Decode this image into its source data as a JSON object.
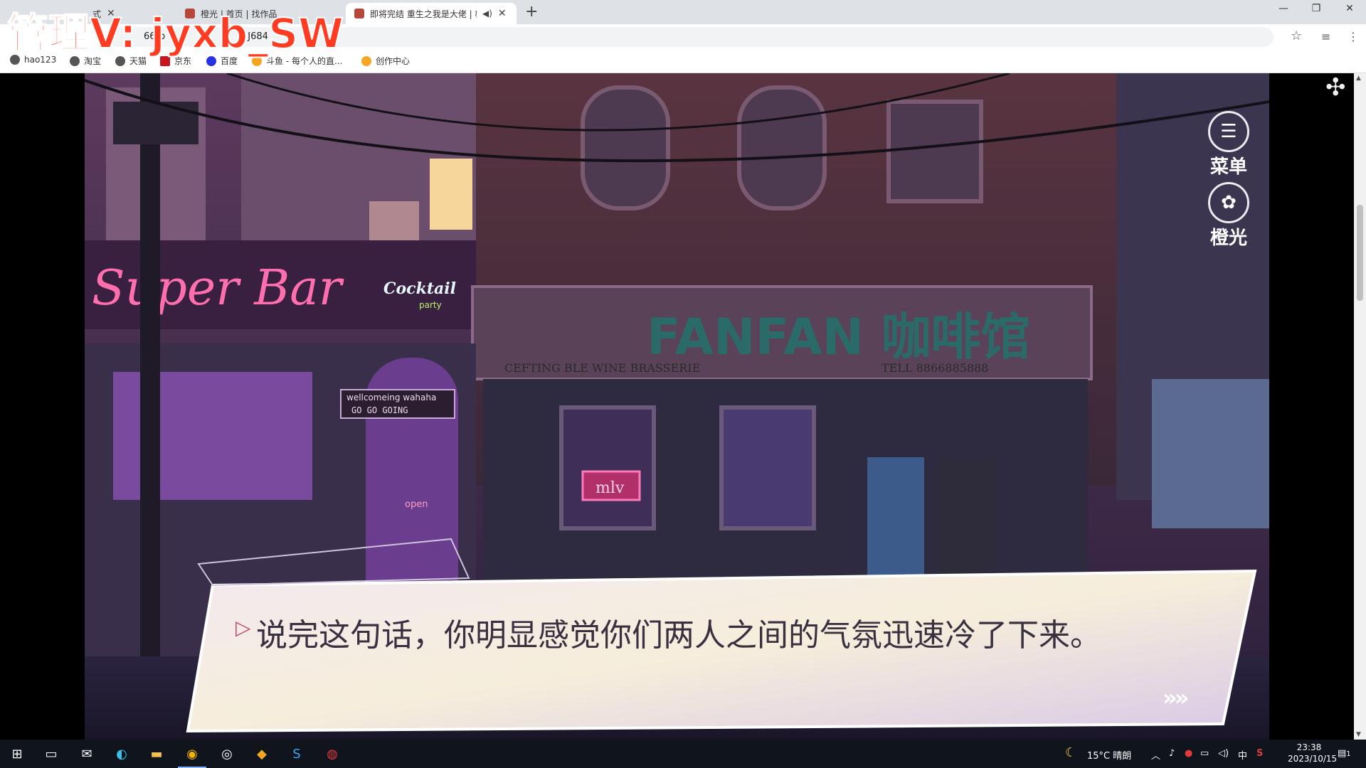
{
  "browser": {
    "tabs": [
      {
        "title": "式",
        "active": false
      },
      {
        "title": "橙光 | 首页 | 找作品",
        "active": false
      },
      {
        "title": "即将完结 重生之我是大佬 | 橙",
        "active": true
      }
    ],
    "url": "66rp",
    "url_suffix": "J684",
    "bookmarks": [
      "hao123",
      "淘宝",
      "天猫",
      "京东",
      "百度",
      "斗鱼 - 每个人的直...",
      "创作中心"
    ]
  },
  "watermark": "管理V: jyxb_SW",
  "game": {
    "menu_label": "菜单",
    "orange_label": "橙光",
    "dialog_text": "说完这句话，你明显感觉你们两人之间的气氛迅速冷了下来。",
    "advance_symbol": "»»",
    "scene": {
      "bar_sign": "Super Bar",
      "cocktail_sign": "Cocktail",
      "cocktail_sub": "party",
      "cafe_sign": "FANFAN 咖啡馆",
      "cafe_subline": "CEFTING BLE WINE BRASSERIE",
      "cafe_tel": "TELL 8866885888",
      "door_sign_line1": "wellcomeing wahaha",
      "door_sign_line2": "GO GO GOING",
      "open_sign": "open",
      "mtv_sign": "mlv"
    }
  },
  "taskbar": {
    "weather": "15°C 晴朗",
    "ime": "中",
    "time": "23:38",
    "date": "2023/10/15",
    "notification_count": "1"
  }
}
